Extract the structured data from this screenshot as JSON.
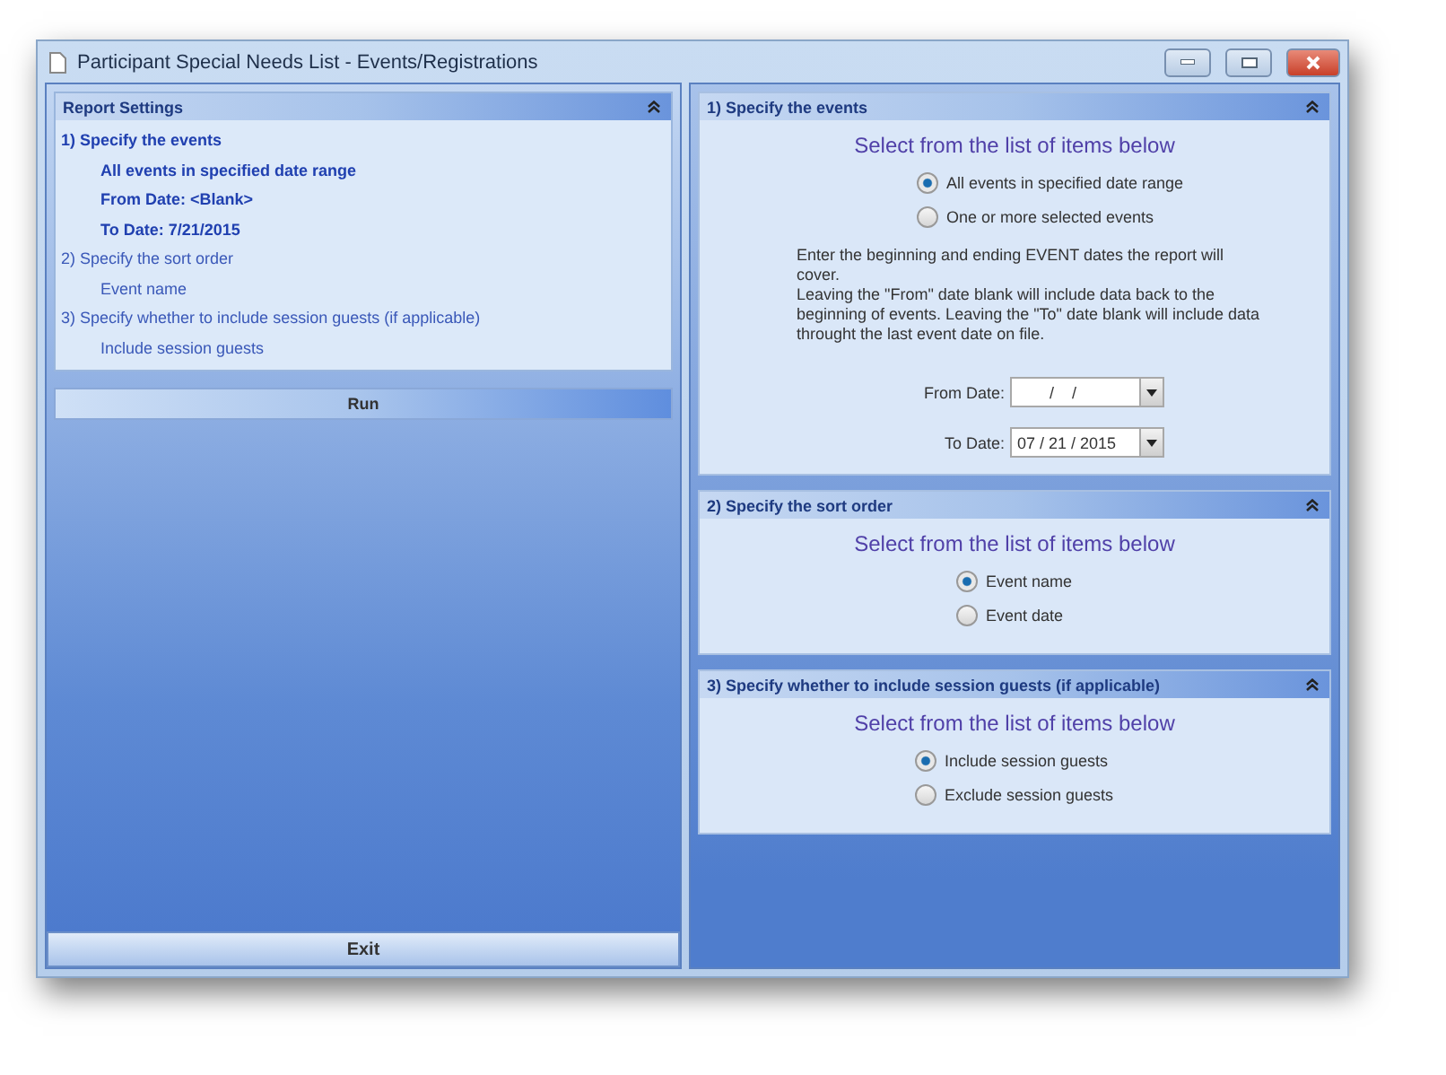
{
  "window": {
    "title": "Participant Special Needs List - Events/Registrations"
  },
  "report_settings": {
    "title": "Report Settings",
    "sections": [
      {
        "heading": "1)  Specify the events",
        "active": true,
        "values": [
          "All events in specified date range",
          "From Date:  <Blank>",
          "To Date:  7/21/2015"
        ]
      },
      {
        "heading": "2)  Specify the sort order",
        "active": false,
        "values": [
          "Event name"
        ]
      },
      {
        "heading": "3)  Specify whether to include session guests (if applicable)",
        "active": false,
        "values": [
          "Include session guests"
        ]
      }
    ]
  },
  "run_button": "Run",
  "exit_button": "Exit",
  "panels": [
    {
      "title": "1)  Specify the events",
      "prompt": "Select from the list of items below",
      "options": [
        {
          "label": "All events in specified date range",
          "selected": true
        },
        {
          "label": "One or more selected events",
          "selected": false
        }
      ],
      "notes": [
        "Enter the beginning and ending EVENT dates the report will cover.",
        "Leaving the \"From\" date blank will include data back to the beginning of events.  Leaving the \"To\" date blank will include data throught the last event date on file."
      ],
      "dates": [
        {
          "label": "From Date:",
          "value": "  /    /"
        },
        {
          "label": "To Date:",
          "value": "07 / 21 / 2015"
        }
      ]
    },
    {
      "title": "2)  Specify the sort order",
      "prompt": "Select from the list of items below",
      "options": [
        {
          "label": "Event name",
          "selected": true
        },
        {
          "label": "Event date",
          "selected": false
        }
      ]
    },
    {
      "title": "3)  Specify whether to include session guests (if applicable)",
      "prompt": "Select from the list of items below",
      "options": [
        {
          "label": "Include session guests",
          "selected": true
        },
        {
          "label": "Exclude session guests",
          "selected": false
        }
      ]
    }
  ]
}
